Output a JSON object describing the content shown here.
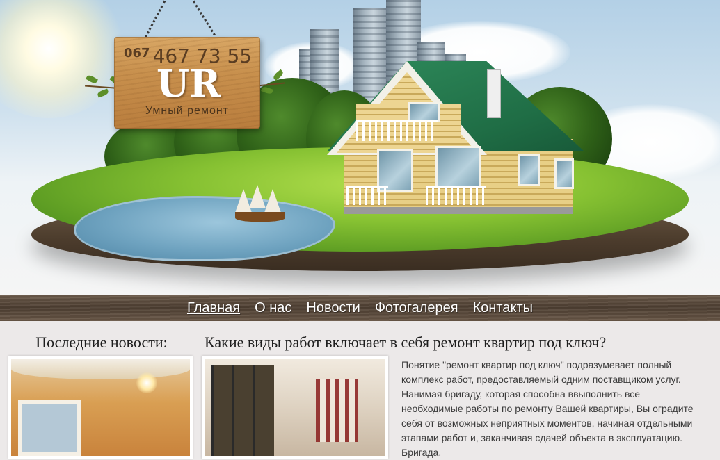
{
  "header": {
    "sign_phone_prefix": "067",
    "sign_phone_number": "467 73 55",
    "sign_logo": "UR",
    "sign_subtitle": "Умный ремонт"
  },
  "nav": {
    "items": [
      {
        "label": "Главная",
        "active": true
      },
      {
        "label": "О нас",
        "active": false
      },
      {
        "label": "Новости",
        "active": false
      },
      {
        "label": "Фотогалерея",
        "active": false
      },
      {
        "label": "Контакты",
        "active": false
      }
    ]
  },
  "sidebar": {
    "title": "Последние новости:"
  },
  "article": {
    "title": "Какие виды работ включает в себя ремонт квартир под ключ?",
    "text": "Понятие \"ремонт квартир под ключ\" подразумевает полный комплекс работ, предоставляемый одним поставщиком услуг. Нанимая бригаду, которая способна ввыполнить все необходимые работы по ремонту Вашей квартиры, Вы оградите себя от возможных неприятных моментов, начиная отдельными этапами работ и, заканчивая сдачей объекта в эксплуатацию. Бригада,"
  }
}
